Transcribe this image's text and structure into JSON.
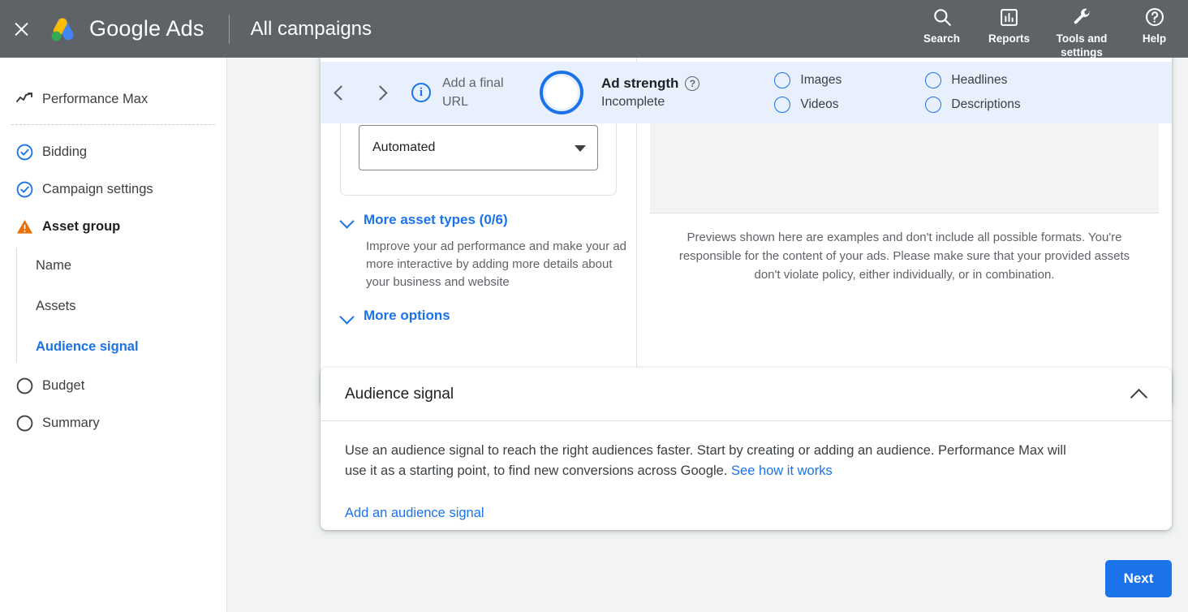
{
  "topbar": {
    "close_icon": "close-icon",
    "brand": "Google Ads",
    "context": "All campaigns",
    "actions": [
      {
        "icon": "search-icon",
        "label": "Search"
      },
      {
        "icon": "reports-icon",
        "label": "Reports"
      },
      {
        "icon": "tools-icon",
        "label": "Tools and settings"
      },
      {
        "icon": "help-icon",
        "label": "Help"
      }
    ]
  },
  "sidebar": {
    "campaign_type": {
      "icon": "performance-max-icon",
      "label": "Performance Max"
    },
    "steps": [
      {
        "icon": "check-circle-icon",
        "label": "Bidding",
        "state": "complete"
      },
      {
        "icon": "check-circle-icon",
        "label": "Campaign settings",
        "state": "complete"
      },
      {
        "icon": "warning-icon",
        "label": "Asset group",
        "state": "warning"
      }
    ],
    "sub_steps": [
      {
        "label": "Name",
        "active": false
      },
      {
        "label": "Assets",
        "active": false
      },
      {
        "label": "Audience signal",
        "active": true
      }
    ],
    "later_steps": [
      {
        "icon": "empty-circle-icon",
        "label": "Budget"
      },
      {
        "icon": "empty-circle-icon",
        "label": "Summary"
      }
    ]
  },
  "adstrength_bar": {
    "prev_icon": "chevron-left-icon",
    "next_icon": "chevron-right-icon",
    "info_icon": "info-icon",
    "info_text": "Add a final URL",
    "ring_icon": "ad-strength-ring-icon",
    "title": "Ad strength",
    "help_icon": "help-circle-icon",
    "status": "Incomplete",
    "checks_left": [
      {
        "label": "Images",
        "checked": false
      },
      {
        "label": "Videos",
        "checked": false
      }
    ],
    "checks_right": [
      {
        "label": "Headlines",
        "checked": false
      },
      {
        "label": "Descriptions",
        "checked": false
      }
    ]
  },
  "asset_card": {
    "select_value": "Automated",
    "select_caret_icon": "chevron-down-icon",
    "more_asset_types": {
      "chevron_icon": "chevron-down-icon",
      "label": "More asset types (0/6)",
      "description": "Improve your ad performance and make your ad more interactive by adding more details about your business and website"
    },
    "more_options": {
      "chevron_icon": "chevron-down-icon",
      "label": "More options"
    },
    "preview_note": "Previews shown here are examples and don't include all possible formats. You're responsible for the content of your ads. Please make sure that your provided assets don't violate policy, either individually, or in combination."
  },
  "audience_signal": {
    "title": "Audience signal",
    "collapse_icon": "chevron-up-icon",
    "description_part1": "Use an audience signal to reach the right audiences faster. Start by creating or adding an audience. Performance Max will use it as a starting point, to find new conversions across Google. ",
    "learn_more": "See how it works",
    "add_link": "Add an audience signal"
  },
  "footer": {
    "next_label": "Next"
  },
  "colors": {
    "topbar_bg": "#5f6368",
    "accent_blue": "#1a73e8",
    "toolbar_bg": "#e8f0fe",
    "warning_orange": "#e8710a",
    "page_bg": "#f1f3f4"
  }
}
